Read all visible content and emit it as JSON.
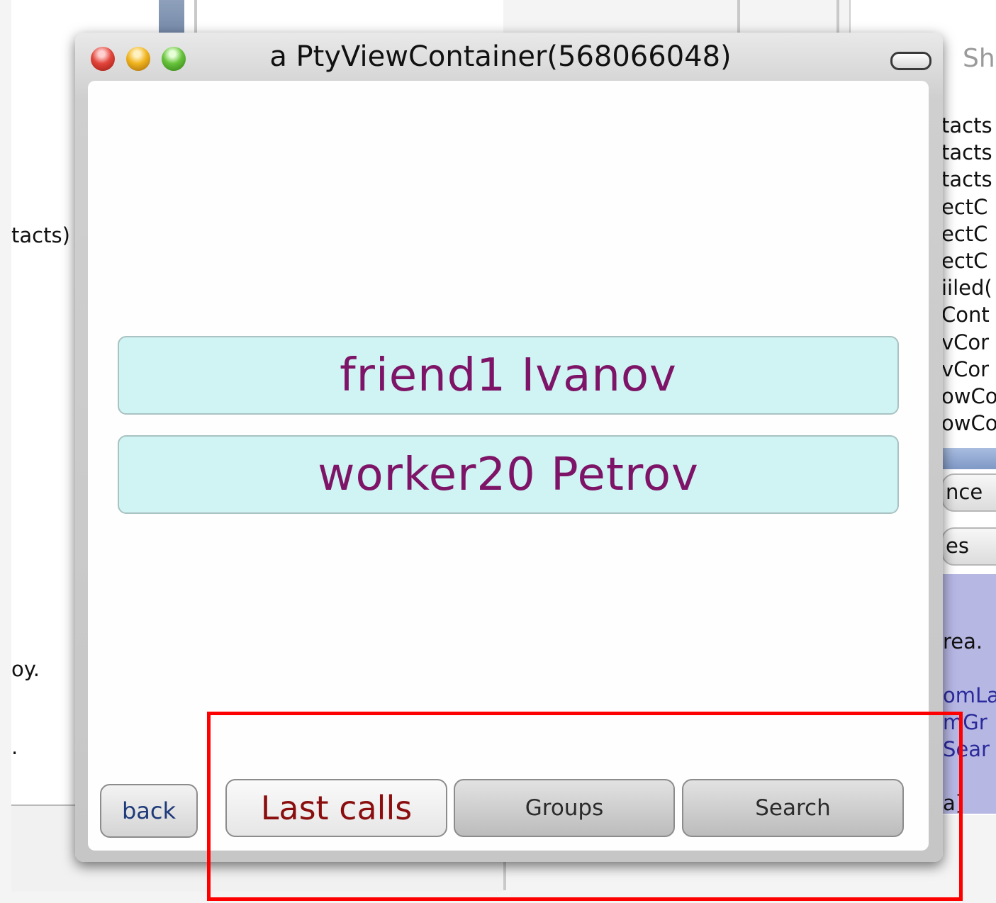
{
  "window": {
    "title": "a PtyViewContainer(568066048)"
  },
  "contacts": [
    {
      "label": "friend1 Ivanov"
    },
    {
      "label": "worker20 Petrov"
    }
  ],
  "nav": {
    "back_label": "back",
    "tabs": [
      {
        "label": "Last calls",
        "selected": true
      },
      {
        "label": "Groups",
        "selected": false
      },
      {
        "label": "Search",
        "selected": false
      }
    ]
  },
  "background": {
    "left_fragments": [
      "tacts)",
      "oy.",
      "."
    ],
    "right_header": "Sh",
    "right_list": [
      "tacts",
      "tacts",
      "tacts",
      "ectC",
      "ectC",
      "ectC",
      "iiled(",
      "Cont",
      "vCor",
      "vCor",
      "owCo",
      "owCo"
    ],
    "right_buttons": [
      "nce",
      "es"
    ],
    "right_code": [
      "rea.",
      "omLa",
      "mGr",
      "Sear",
      "a]"
    ]
  },
  "colors": {
    "contact_bg": "#d0f3f3",
    "contact_text": "#7e1467",
    "selected_tab_text": "#8a0e0e",
    "highlight": "#ff0000"
  }
}
